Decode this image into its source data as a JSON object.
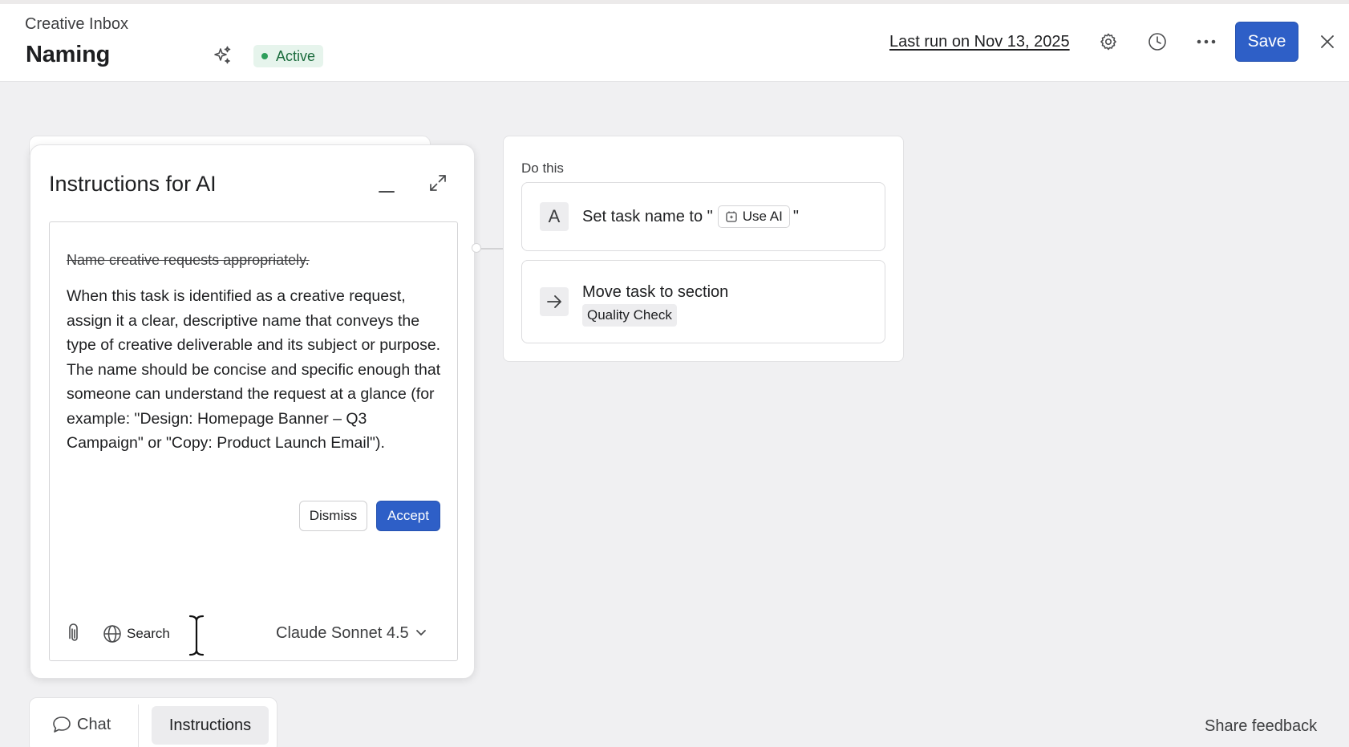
{
  "header": {
    "breadcrumb": "Creative Inbox",
    "title": "Naming",
    "status": "Active",
    "last_run": "Last run on Nov 13, 2025",
    "save_label": "Save",
    "icons": [
      "sparkle-icon",
      "gear-icon",
      "clock-icon",
      "more-icon",
      "close-icon"
    ]
  },
  "instructions_panel": {
    "title": "Instructions for AI",
    "struck_text": "Name creative requests appropriately.",
    "suggested_text": "When this task is identified as a creative request, assign it a clear, descriptive name that conveys the type of creative deliverable and its subject or purpose. The name should be concise and specific enough that someone can understand the request at a glance (for example: \"Design: Homepage Banner – Q3 Campaign\" or \"Copy: Product Launch Email\").",
    "dismiss_label": "Dismiss",
    "accept_label": "Accept",
    "search_label": "Search",
    "model": "Claude Sonnet 4.5"
  },
  "actions": {
    "heading": "Do this",
    "set_name_prefix": "Set task name to \"",
    "set_name_suffix": "\"",
    "use_ai_label": "Use AI",
    "move_label": "Move task to section",
    "section_name": "Quality Check"
  },
  "footer": {
    "chat_tab": "Chat",
    "instructions_tab": "Instructions",
    "share_feedback": "Share feedback"
  },
  "colors": {
    "accent": "#2e5fc7",
    "status_bg": "#e6f4ec",
    "status_text": "#1a6b3c",
    "canvas_bg": "#f0f0f2"
  }
}
